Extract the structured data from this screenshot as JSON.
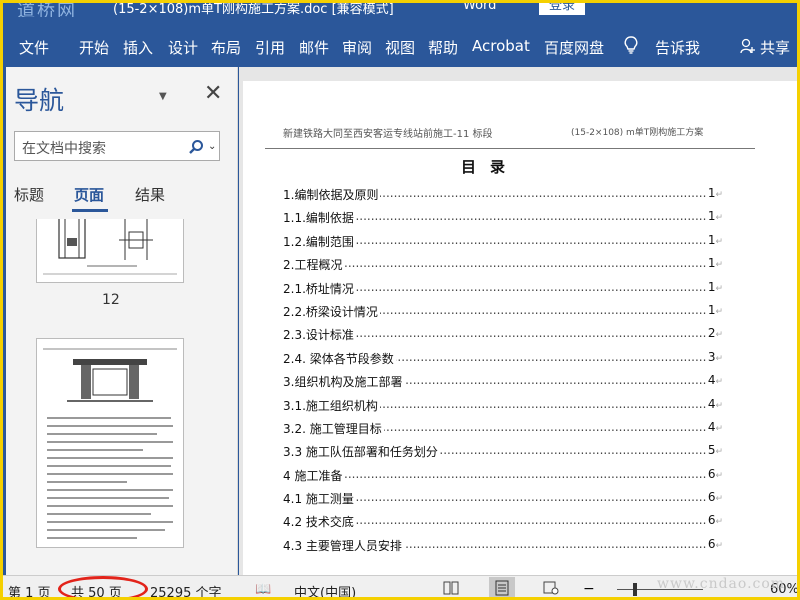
{
  "window": {
    "watermark_logo": "道桥网",
    "doc_title": "(15-2×108)m单T刚构施工方案.doc [兼容模式]",
    "app_name": "Word",
    "login_label": "登录"
  },
  "ribbon": {
    "tabs": [
      "文件",
      "开始",
      "插入",
      "设计",
      "布局",
      "引用",
      "邮件",
      "审阅",
      "视图",
      "帮助",
      "Acrobat",
      "百度网盘"
    ],
    "tell_me": "告诉我",
    "share": "共享"
  },
  "nav_pane": {
    "title": "导航",
    "search_placeholder": "在文档中搜索",
    "tabs": [
      "标题",
      "页面",
      "结果"
    ],
    "active_tab": "页面",
    "page_number_label": "12"
  },
  "document": {
    "header_left": "新建铁路大同至西安客运专线站前施工-11 标段",
    "header_right": "(15-2×108) m单T刚构施工方案",
    "toc_title": "目录",
    "toc": [
      {
        "label": "1.编制依据及原则",
        "page": "1"
      },
      {
        "label": "1.1.编制依据",
        "page": "1"
      },
      {
        "label": "1.2.编制范围",
        "page": "1"
      },
      {
        "label": "2.工程概况",
        "page": "1"
      },
      {
        "label": "2.1.桥址情况",
        "page": "1"
      },
      {
        "label": "2.2.桥梁设计情况",
        "page": "1"
      },
      {
        "label": "2.3.设计标准",
        "page": "2"
      },
      {
        "label": "2.4. 梁体各节段参数",
        "page": "3"
      },
      {
        "label": "3.组织机构及施工部署",
        "page": "4"
      },
      {
        "label": "3.1.施工组织机构",
        "page": "4"
      },
      {
        "label": "3.2. 施工管理目标",
        "page": "4"
      },
      {
        "label": "3.3 施工队伍部署和任务划分",
        "page": "5"
      },
      {
        "label": "4 施工准备",
        "page": "6"
      },
      {
        "label": "4.1 施工测量",
        "page": "6"
      },
      {
        "label": "4.2 技术交底",
        "page": "6"
      },
      {
        "label": "4.3 主要管理人员安排",
        "page": "6"
      }
    ]
  },
  "status_bar": {
    "page_info": "第 1 页",
    "total_pages": "共 50 页",
    "word_count": "25295 个字",
    "language": "中文(中国)",
    "zoom": "60%",
    "watermark_site": "www.cndao.com"
  },
  "colors": {
    "ribbon_blue": "#2b579a",
    "highlight_circle": "#e2231a",
    "frame_border": "#f5d000"
  }
}
